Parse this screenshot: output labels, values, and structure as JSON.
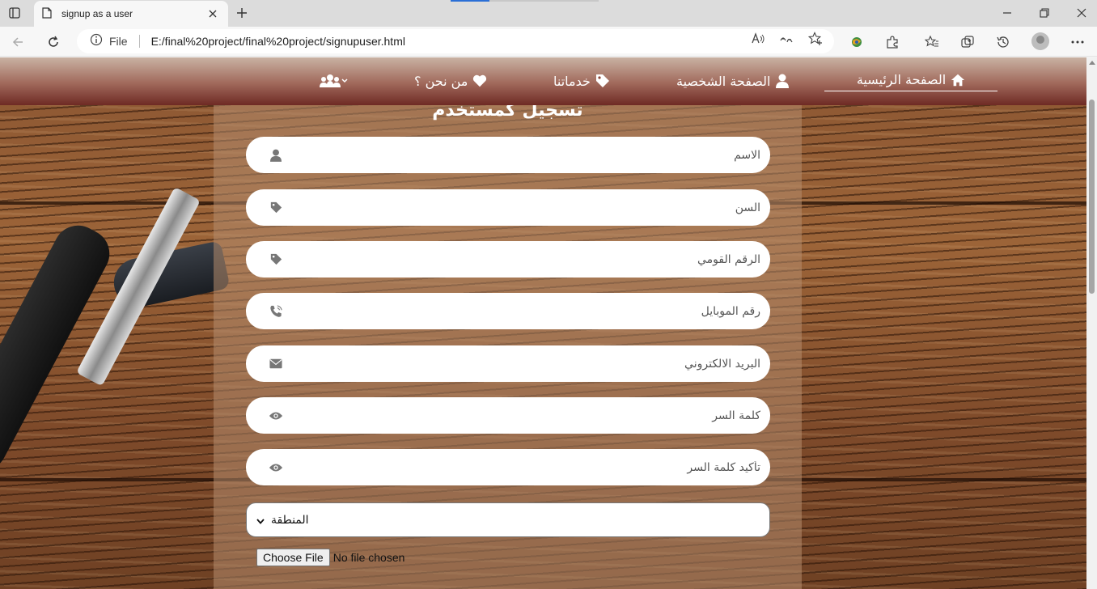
{
  "browser": {
    "tab_title": "signup as a user",
    "file_label": "File",
    "url": "E:/final%20project/final%20project/signupuser.html",
    "read_aloud_label": "Â",
    "translate_label": "a̧"
  },
  "nav": {
    "items": [
      {
        "label": "الصفحة الرئيسية",
        "icon": "home-icon"
      },
      {
        "label": "الصفحة الشخصية",
        "icon": "user-icon"
      },
      {
        "label": "خدماتنا",
        "icon": "tag-icon"
      },
      {
        "label": "من نحن ؟",
        "icon": "heart-icon"
      }
    ],
    "users_menu_icon": "users-dropdown-icon"
  },
  "form": {
    "title": "تسجيل كمستخدم",
    "fields": [
      {
        "placeholder": "الاسم",
        "icon": "user-icon"
      },
      {
        "placeholder": "السن",
        "icon": "tag-icon"
      },
      {
        "placeholder": "الرقم القومي",
        "icon": "tag-icon"
      },
      {
        "placeholder": "رقم الموبايل",
        "icon": "phone-icon"
      },
      {
        "placeholder": "البريد الالكتروني",
        "icon": "envelope-icon"
      },
      {
        "placeholder": "كلمة السر",
        "icon": "eye-icon"
      },
      {
        "placeholder": "تأكيد كلمة السر",
        "icon": "eye-icon"
      }
    ],
    "region_select": "المنطقة",
    "file_button": "Choose File",
    "file_status": "No file chosen"
  }
}
